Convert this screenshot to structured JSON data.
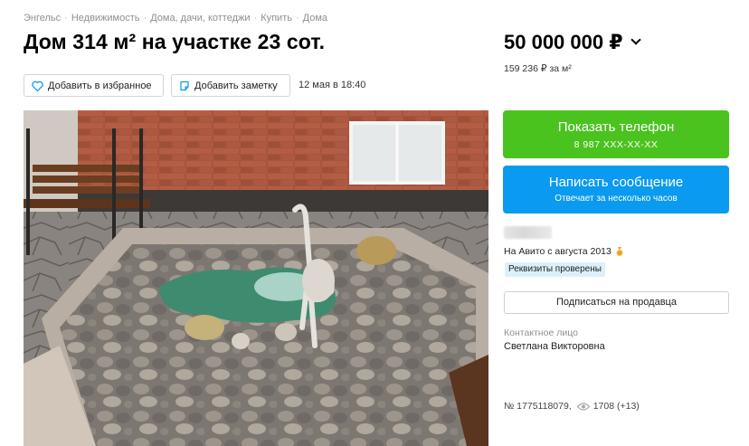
{
  "breadcrumbs": [
    "Энгельс",
    "Недвижимость",
    "Дома, дачи, коттеджи",
    "Купить",
    "Дома"
  ],
  "title": "Дом 314 м² на участке 23 сот.",
  "price": {
    "value": "50 000 000 ₽",
    "per_meter": "159 236 ₽ за м²"
  },
  "actions": {
    "favorite_label": "Добавить в избранное",
    "note_label": "Добавить заметку",
    "date": "12 мая в 18:40"
  },
  "contact_buttons": {
    "phone_label": "Показать телефон",
    "phone_masked": "8 987 XXX-XX-XX",
    "message_label": "Написать сообщение",
    "message_sub": "Отвечает за несколько часов"
  },
  "seller": {
    "since": "На Авито с августа 2013",
    "verified_badge": "Реквизиты проверены",
    "subscribe_label": "Подписаться на продавца",
    "contact_label": "Контактное лицо",
    "contact_name": "Светлана Викторовна"
  },
  "ad": {
    "number": "№ 1775118079,",
    "views": "1708 (+13)"
  },
  "colors": {
    "phone_button": "#4ac31e",
    "message_button": "#0a9af0",
    "verified_bg": "#dcf0fb"
  },
  "icons": {
    "favorite": "heart-icon",
    "note": "note-icon",
    "price_toggle": "chevron-down-icon",
    "medal": "medal-icon",
    "views": "eye-icon"
  }
}
